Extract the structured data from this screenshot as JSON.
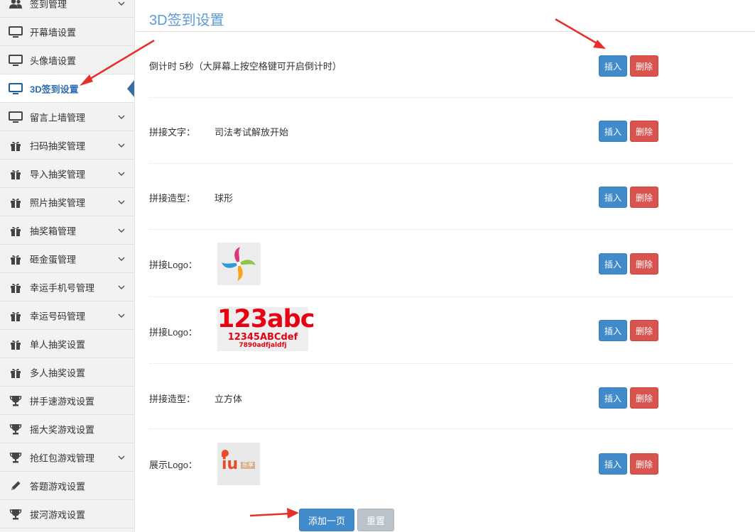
{
  "sidebar": {
    "items": [
      {
        "label": "签到管理",
        "icon": "users-icon",
        "has_chevron": true
      },
      {
        "label": "开幕墙设置",
        "icon": "monitor-icon",
        "has_chevron": false
      },
      {
        "label": "头像墙设置",
        "icon": "monitor-icon",
        "has_chevron": false
      },
      {
        "label": "3D签到设置",
        "icon": "monitor-icon",
        "has_chevron": false,
        "active": true
      },
      {
        "label": "留言上墙管理",
        "icon": "monitor-icon",
        "has_chevron": true
      },
      {
        "label": "扫码抽奖管理",
        "icon": "gift-icon",
        "has_chevron": true
      },
      {
        "label": "导入抽奖管理",
        "icon": "gift-icon",
        "has_chevron": true
      },
      {
        "label": "照片抽奖管理",
        "icon": "gift-icon",
        "has_chevron": true
      },
      {
        "label": "抽奖箱管理",
        "icon": "gift-icon",
        "has_chevron": true
      },
      {
        "label": "砸金蛋管理",
        "icon": "gift-icon",
        "has_chevron": true
      },
      {
        "label": "幸运手机号管理",
        "icon": "gift-icon",
        "has_chevron": true
      },
      {
        "label": "幸运号码管理",
        "icon": "gift-icon",
        "has_chevron": true
      },
      {
        "label": "单人抽奖设置",
        "icon": "gift-icon",
        "has_chevron": false
      },
      {
        "label": "多人抽奖设置",
        "icon": "gift-icon",
        "has_chevron": false
      },
      {
        "label": "拼手速游戏设置",
        "icon": "trophy-icon",
        "has_chevron": false
      },
      {
        "label": "摇大奖游戏设置",
        "icon": "trophy-icon",
        "has_chevron": false
      },
      {
        "label": "抢红包游戏管理",
        "icon": "trophy-icon",
        "has_chevron": true
      },
      {
        "label": "答题游戏设置",
        "icon": "pencil-icon",
        "has_chevron": false
      },
      {
        "label": "拔河游戏设置",
        "icon": "trophy-icon",
        "has_chevron": false
      }
    ]
  },
  "main": {
    "title": "3D签到设置",
    "rows": [
      {
        "label": "倒计时 5秒（大屏幕上按空格键可开启倒计时）",
        "value": ""
      },
      {
        "label": "拼接文字：",
        "value": "司法考试解放开始"
      },
      {
        "label": "拼接造型：",
        "value": "球形"
      },
      {
        "label": "拼接Logo：",
        "value": ""
      },
      {
        "label": "拼接Logo：",
        "value": "",
        "logo_text": {
          "line1": "123abc",
          "line2": "12345ABCdef",
          "line3": "7890adfjaldfj"
        }
      },
      {
        "label": "拼接造型：",
        "value": "立方体"
      },
      {
        "label": "展示Logo：",
        "value": "",
        "logo_text": {
          "mark": "iu",
          "small": "乐享"
        }
      }
    ],
    "insert_label": "插入",
    "delete_label": "删除",
    "add_page_label": "添加一页",
    "reset_label": "重置"
  },
  "colors": {
    "primary": "#428bca",
    "danger": "#d9534f",
    "title": "#5b9bd5",
    "arrow": "#e8302a"
  }
}
